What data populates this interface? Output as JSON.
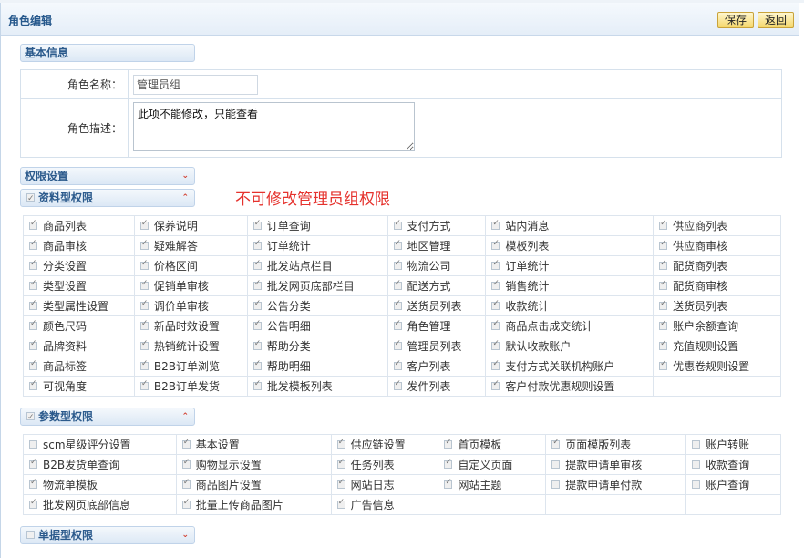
{
  "header": {
    "title": "角色编辑",
    "save_label": "保存",
    "back_label": "返回"
  },
  "basic": {
    "tab_label": "基本信息",
    "name_label": "角色名称：",
    "name_value": "管理员组",
    "desc_label": "角色描述：",
    "desc_value": "此项不能修改，只能查看"
  },
  "perm": {
    "tab_label": "权限设置",
    "notice": "不可修改管理员组权限",
    "data_group": {
      "label": "资料型权限",
      "rows": [
        [
          {
            "t": "商品列表",
            "c": true
          },
          {
            "t": "保养说明",
            "c": true
          },
          {
            "t": "订单查询",
            "c": true
          },
          {
            "t": "支付方式",
            "c": true
          },
          {
            "t": "站内消息",
            "c": true
          },
          {
            "t": "供应商列表",
            "c": true
          }
        ],
        [
          {
            "t": "商品审核",
            "c": true
          },
          {
            "t": "疑难解答",
            "c": true
          },
          {
            "t": "订单统计",
            "c": true
          },
          {
            "t": "地区管理",
            "c": true
          },
          {
            "t": "模板列表",
            "c": true
          },
          {
            "t": "供应商审核",
            "c": true
          }
        ],
        [
          {
            "t": "分类设置",
            "c": true
          },
          {
            "t": "价格区间",
            "c": true
          },
          {
            "t": "批发站点栏目",
            "c": true
          },
          {
            "t": "物流公司",
            "c": true
          },
          {
            "t": "订单统计",
            "c": true
          },
          {
            "t": "配货商列表",
            "c": true
          }
        ],
        [
          {
            "t": "类型设置",
            "c": true
          },
          {
            "t": "促销单审核",
            "c": true
          },
          {
            "t": "批发网页底部栏目",
            "c": true
          },
          {
            "t": "配送方式",
            "c": true
          },
          {
            "t": "销售统计",
            "c": true
          },
          {
            "t": "配货商审核",
            "c": true
          }
        ],
        [
          {
            "t": "类型属性设置",
            "c": true
          },
          {
            "t": "调价单审核",
            "c": true
          },
          {
            "t": "公告分类",
            "c": true
          },
          {
            "t": "送货员列表",
            "c": true
          },
          {
            "t": "收款统计",
            "c": true
          },
          {
            "t": "送货员列表",
            "c": true
          }
        ],
        [
          {
            "t": "颜色尺码",
            "c": true
          },
          {
            "t": "新品时效设置",
            "c": true
          },
          {
            "t": "公告明细",
            "c": true
          },
          {
            "t": "角色管理",
            "c": true
          },
          {
            "t": "商品点击成交统计",
            "c": true
          },
          {
            "t": "账户余额查询",
            "c": true
          }
        ],
        [
          {
            "t": "品牌资料",
            "c": true
          },
          {
            "t": "热销统计设置",
            "c": true
          },
          {
            "t": "帮助分类",
            "c": true
          },
          {
            "t": "管理员列表",
            "c": true
          },
          {
            "t": "默认收款账户",
            "c": true
          },
          {
            "t": "充值规则设置",
            "c": true
          }
        ],
        [
          {
            "t": "商品标签",
            "c": true
          },
          {
            "t": "B2B订单浏览",
            "c": true
          },
          {
            "t": "帮助明细",
            "c": true
          },
          {
            "t": "客户列表",
            "c": true
          },
          {
            "t": "支付方式关联机构账户",
            "c": true
          },
          {
            "t": "优惠卷规则设置",
            "c": true
          }
        ],
        [
          {
            "t": "可视角度",
            "c": true
          },
          {
            "t": "B2B订单发货",
            "c": true
          },
          {
            "t": "批发模板列表",
            "c": true
          },
          {
            "t": "发件列表",
            "c": true
          },
          {
            "t": "客户付款优惠规则设置",
            "c": true
          },
          null
        ]
      ]
    },
    "param_group": {
      "label": "参数型权限",
      "rows": [
        [
          {
            "t": "scm星级评分设置",
            "c": false
          },
          {
            "t": "基本设置",
            "c": true
          },
          {
            "t": "供应链设置",
            "c": true
          },
          {
            "t": "首页模板",
            "c": true
          },
          {
            "t": "页面模版列表",
            "c": true
          },
          {
            "t": "账户转账",
            "c": false
          }
        ],
        [
          {
            "t": "B2B发货单查询",
            "c": true
          },
          {
            "t": "购物显示设置",
            "c": true
          },
          {
            "t": "任务列表",
            "c": true
          },
          {
            "t": "自定义页面",
            "c": true
          },
          {
            "t": "提款申请单审核",
            "c": false
          },
          {
            "t": "收款查询",
            "c": false
          }
        ],
        [
          {
            "t": "物流单模板",
            "c": true
          },
          {
            "t": "商品图片设置",
            "c": true
          },
          {
            "t": "网站日志",
            "c": true
          },
          {
            "t": "网站主题",
            "c": true
          },
          {
            "t": "提款申请单付款",
            "c": false
          },
          {
            "t": "账户查询",
            "c": false
          }
        ],
        [
          {
            "t": "批发网页底部信息",
            "c": true
          },
          {
            "t": "批量上传商品图片",
            "c": true
          },
          {
            "t": "广告信息",
            "c": true
          },
          null,
          null,
          null
        ]
      ]
    },
    "bill_group": {
      "label": "单据型权限"
    }
  }
}
